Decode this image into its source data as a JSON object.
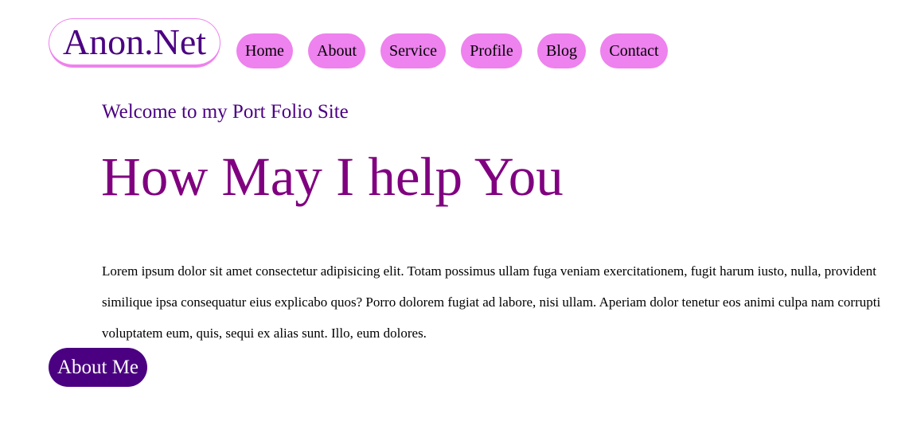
{
  "logo": {
    "text": "Anon.Net"
  },
  "nav": {
    "items": [
      {
        "label": "Home"
      },
      {
        "label": "About"
      },
      {
        "label": "Service"
      },
      {
        "label": "Profile"
      },
      {
        "label": "Blog"
      },
      {
        "label": "Contact"
      }
    ]
  },
  "hero": {
    "welcome": "Welcome to my Port Folio Site",
    "headline": "How May I help You",
    "paragraph": "Lorem ipsum dolor sit amet consectetur adipisicing elit. Totam possimus ullam fuga veniam exercitationem, fugit harum iusto, nulla, provident similique ipsa consequatur eius explicabo quos? Porro dolorem fugiat ad labore, nisi ullam. Aperiam dolor tenetur eos animi culpa nam corrupti voluptatem eum, quis, sequi ex alias sunt. Illo, eum dolores."
  },
  "cta": {
    "about_label": "About Me"
  },
  "colors": {
    "nav_bg": "#ee82ee",
    "logo_text": "#4b0082",
    "headline": "#800080",
    "button_bg": "#4b0082"
  }
}
